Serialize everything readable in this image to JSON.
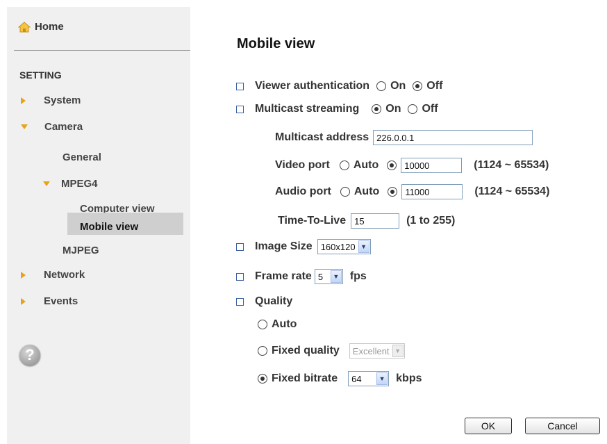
{
  "sidebar": {
    "home": "Home",
    "section": "SETTING",
    "system": "System",
    "camera": "Camera",
    "general": "General",
    "mpeg4": "MPEG4",
    "computer_view": "Computer view",
    "mobile_view": "Mobile view",
    "mjpeg": "MJPEG",
    "network": "Network",
    "events": "Events",
    "help": "?"
  },
  "main": {
    "title": "Mobile view",
    "viewer_auth": {
      "label": "Viewer authentication",
      "on": "On",
      "off": "Off",
      "selected": "Off"
    },
    "multicast": {
      "label": "Multicast streaming",
      "on": "On",
      "off": "Off",
      "selected": "On"
    },
    "multicast_address": {
      "label": "Multicast address",
      "value": "226.0.0.1"
    },
    "video_port": {
      "label": "Video port",
      "auto": "Auto",
      "value": "10000",
      "range": "(1124 ~ 65534)"
    },
    "audio_port": {
      "label": "Audio port",
      "auto": "Auto",
      "value": "11000",
      "range": "(1124 ~ 65534)"
    },
    "ttl": {
      "label": "Time-To-Live",
      "value": "15",
      "range": "(1 to 255)"
    },
    "image_size": {
      "label": "Image Size",
      "value": "160x120"
    },
    "frame_rate": {
      "label": "Frame rate",
      "value": "5",
      "unit": "fps"
    },
    "quality": {
      "label": "Quality",
      "auto": "Auto",
      "fixed_quality": "Fixed quality",
      "fixed_quality_value": "Excellent",
      "fixed_bitrate": "Fixed bitrate",
      "bitrate_value": "64",
      "unit": "kbps",
      "selected": "Fixed bitrate"
    },
    "ok": "OK",
    "cancel": "Cancel"
  },
  "colors": {
    "accent_triangle": "#e8a317",
    "sidebar_bg": "#f0f0f0",
    "active_bg": "#cfcfcf",
    "bullet": "#3a5fa0"
  }
}
